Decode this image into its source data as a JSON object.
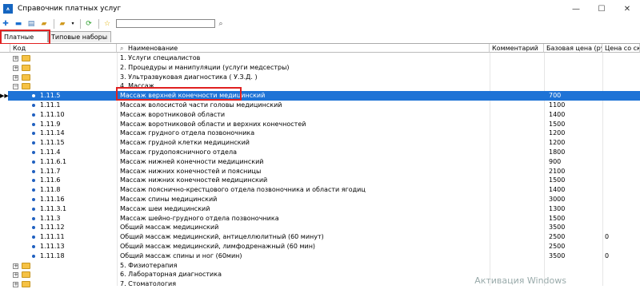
{
  "window": {
    "title": "Справочник платных услуг",
    "icon_text": "ᴧ"
  },
  "toolbar": {
    "search_value": "",
    "buttons": [
      "add",
      "remove",
      "edit",
      "open",
      "export",
      "refresh",
      "favorite"
    ]
  },
  "tabs": [
    {
      "label": "Платные услуги",
      "active": true
    },
    {
      "label": "Типовые наборы услуг",
      "active": false
    }
  ],
  "columns": {
    "code": "Код",
    "name": "Наименование",
    "comment": "Комментарий",
    "price": "Базовая цена (ру...",
    "extra": "Цена со скид"
  },
  "rows": [
    {
      "type": "group",
      "expander": "+",
      "code": "",
      "name": "1. Услуги специалистов",
      "comment": "",
      "price": "",
      "extra": ""
    },
    {
      "type": "group",
      "expander": "+",
      "code": "",
      "name": "2. Процедуры и манипуляции (услуги медсестры)",
      "comment": "",
      "price": "",
      "extra": ""
    },
    {
      "type": "group",
      "expander": "+",
      "code": "",
      "name": "3. Ультразвуковая диагностика ( У.З.Д. )",
      "comment": "",
      "price": "",
      "extra": ""
    },
    {
      "type": "group",
      "expander": "−",
      "code": "",
      "name": "4. Массаж",
      "comment": "",
      "price": "",
      "extra": ""
    },
    {
      "type": "item",
      "selected": true,
      "code": "1.11.5",
      "name": "Массаж верхней конечности медицинский",
      "comment": "",
      "price": "700",
      "extra": ""
    },
    {
      "type": "item",
      "code": "1.11.1",
      "name": "Массаж волосистой части головы медицинский",
      "comment": "",
      "price": "1100",
      "extra": ""
    },
    {
      "type": "item",
      "code": "1.11.10",
      "name": "Массаж воротниковой области",
      "comment": "",
      "price": "1400",
      "extra": ""
    },
    {
      "type": "item",
      "code": "1.11.9",
      "name": "Массаж воротниковой области и верхних конечностей",
      "comment": "",
      "price": "1500",
      "extra": ""
    },
    {
      "type": "item",
      "code": "1.11.14",
      "name": "Массаж грудного отдела позвоночника",
      "comment": "",
      "price": "1200",
      "extra": ""
    },
    {
      "type": "item",
      "code": "1.11.15",
      "name": "Массаж грудной клетки медицинский",
      "comment": "",
      "price": "1200",
      "extra": ""
    },
    {
      "type": "item",
      "code": "1.11.4",
      "name": "Массаж грудопоясничного отдела",
      "comment": "",
      "price": "1800",
      "extra": ""
    },
    {
      "type": "item",
      "code": "1.11.6.1",
      "name": "Массаж нижней конечности медицинский",
      "comment": "",
      "price": "900",
      "extra": ""
    },
    {
      "type": "item",
      "code": "1.11.7",
      "name": "Массаж нижних конечностей и поясницы",
      "comment": "",
      "price": "2100",
      "extra": ""
    },
    {
      "type": "item",
      "code": "1.11.6",
      "name": "Массаж нижних конечностей медицинский",
      "comment": "",
      "price": "1500",
      "extra": ""
    },
    {
      "type": "item",
      "code": "1.11.8",
      "name": "Массаж пояснично-крестцового отдела позвоночника и области ягодиц",
      "comment": "",
      "price": "1400",
      "extra": ""
    },
    {
      "type": "item",
      "code": "1.11.16",
      "name": "Массаж спины медицинский",
      "comment": "",
      "price": "3000",
      "extra": ""
    },
    {
      "type": "item",
      "code": "1.11.3.1",
      "name": "Массаж шеи медицинский",
      "comment": "",
      "price": "1300",
      "extra": ""
    },
    {
      "type": "item",
      "code": "1.11.3",
      "name": "Массаж шейно-грудного отдела позвоночника",
      "comment": "",
      "price": "1500",
      "extra": ""
    },
    {
      "type": "item",
      "code": "1.11.12",
      "name": "Общий массаж медицинский",
      "comment": "",
      "price": "3500",
      "extra": ""
    },
    {
      "type": "item",
      "code": "1.11.11",
      "name": "Общий массаж медицинский, антицеллюлитный (60 минут)",
      "comment": "",
      "price": "2500",
      "extra": "0"
    },
    {
      "type": "item",
      "code": "1.11.13",
      "name": "Общий массаж медицинский, лимфодренажный (60 мин)",
      "comment": "",
      "price": "2500",
      "extra": ""
    },
    {
      "type": "item",
      "code": "1.11.18",
      "name": "Общий массаж спины и ног (60мин)",
      "comment": "",
      "price": "3500",
      "extra": "0"
    },
    {
      "type": "group",
      "expander": "+",
      "code": "",
      "name": "5. Физиотерапия",
      "comment": "",
      "price": "",
      "extra": ""
    },
    {
      "type": "group",
      "expander": "+",
      "code": "",
      "name": "6. Лабораторная диагностика",
      "comment": "",
      "price": "",
      "extra": ""
    },
    {
      "type": "group",
      "expander": "+",
      "code": "",
      "name": "7. Стоматология",
      "comment": "",
      "price": "",
      "extra": ""
    }
  ],
  "watermark": "Активация Windows",
  "colors": {
    "selection": "#1e73d6",
    "highlight_box": "#e02020",
    "folder": "#f6c244"
  }
}
